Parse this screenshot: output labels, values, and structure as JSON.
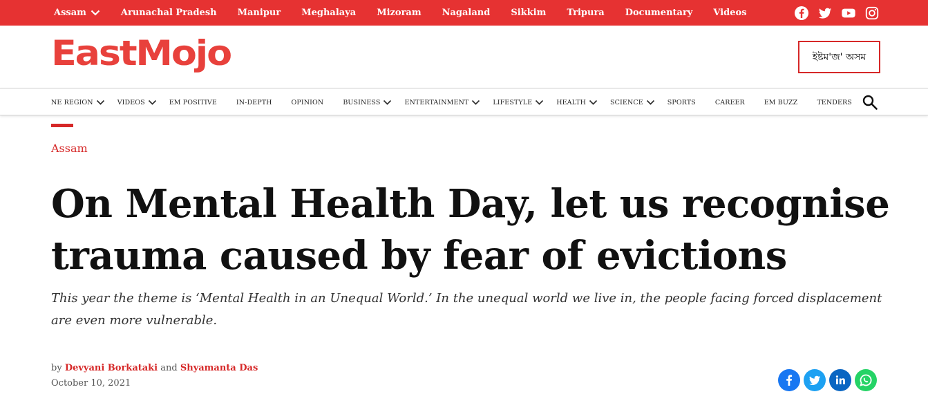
{
  "topnav": {
    "items": [
      {
        "label": "Assam",
        "dropdown": true
      },
      {
        "label": "Arunachal Pradesh"
      },
      {
        "label": "Manipur"
      },
      {
        "label": "Meghalaya"
      },
      {
        "label": "Mizoram"
      },
      {
        "label": "Nagaland"
      },
      {
        "label": "Sikkim"
      },
      {
        "label": "Tripura"
      },
      {
        "label": "Documentary"
      },
      {
        "label": "Videos"
      }
    ],
    "social": [
      "facebook-icon",
      "twitter-icon",
      "youtube-icon",
      "instagram-icon"
    ],
    "background": "#e63232"
  },
  "header": {
    "logo_text": "EastMojo",
    "assam_edition_label": "ইষ্টম'জ' অসম"
  },
  "mainnav": {
    "items": [
      {
        "label": "NE REGION",
        "dropdown": true
      },
      {
        "label": "VIDEOS",
        "dropdown": true
      },
      {
        "label": "EM POSITIVE"
      },
      {
        "label": "IN-DEPTH"
      },
      {
        "label": "OPINION"
      },
      {
        "label": "BUSINESS",
        "dropdown": true
      },
      {
        "label": "ENTERTAINMENT",
        "dropdown": true
      },
      {
        "label": "LIFESTYLE",
        "dropdown": true
      },
      {
        "label": "HEALTH",
        "dropdown": true
      },
      {
        "label": "SCIENCE",
        "dropdown": true
      },
      {
        "label": "SPORTS"
      },
      {
        "label": "CAREER"
      },
      {
        "label": "EM BUZZ"
      },
      {
        "label": "TENDERS"
      }
    ]
  },
  "article": {
    "category": "Assam",
    "headline": "On Mental Health Day, let us recognise trauma caused by fear of evictions",
    "dek": "This year the theme is ‘Mental Health in an Unequal World.’ In the unequal world we live in, the people facing forced displacement are even more vulnerable.",
    "byline_prefix": "by",
    "author1": "Devyani Borkataki",
    "byline_joiner": "and",
    "author2": "Shyamanta Das",
    "date": "October 10, 2021",
    "share": [
      {
        "icon": "facebook-share-icon",
        "color": "#1877f2"
      },
      {
        "icon": "twitter-share-icon",
        "color": "#1da1f2"
      },
      {
        "icon": "linkedin-share-icon",
        "color": "#0a66c2"
      },
      {
        "icon": "whatsapp-share-icon",
        "color": "#25d366"
      }
    ]
  },
  "colors": {
    "brand_red": "#e63232",
    "link_red": "#d62828"
  }
}
